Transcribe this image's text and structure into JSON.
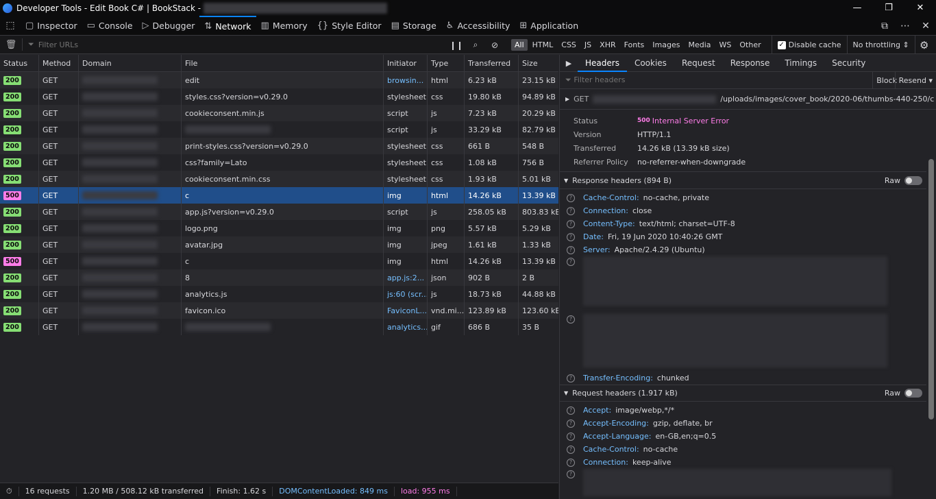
{
  "window": {
    "title": "Developer Tools - Edit Book C# | BookStack -"
  },
  "toolbar": {
    "tools": [
      "Inspector",
      "Console",
      "Debugger",
      "Network",
      "Memory",
      "Style Editor",
      "Storage",
      "Accessibility",
      "Application"
    ]
  },
  "filter": {
    "placeholder": "Filter URLs",
    "types": [
      "All",
      "HTML",
      "CSS",
      "JS",
      "XHR",
      "Fonts",
      "Images",
      "Media",
      "WS",
      "Other"
    ],
    "disable_cache": "Disable cache",
    "throttling": "No throttling ⇕"
  },
  "table": {
    "headers": [
      "Status",
      "Method",
      "Domain",
      "File",
      "Initiator",
      "Type",
      "Transferred",
      "Size"
    ],
    "rows": [
      {
        "status": "200",
        "method": "GET",
        "file": "edit",
        "initiator": "browsin...",
        "type": "html",
        "transferred": "6.23 kB",
        "size": "23.15 kB"
      },
      {
        "status": "200",
        "method": "GET",
        "file": "styles.css?version=v0.29.0",
        "initiator": "stylesheet",
        "type": "css",
        "transferred": "19.80 kB",
        "size": "94.89 kB"
      },
      {
        "status": "200",
        "method": "GET",
        "file": "cookieconsent.min.js",
        "initiator": "script",
        "type": "js",
        "transferred": "7.23 kB",
        "size": "20.29 kB"
      },
      {
        "status": "200",
        "method": "GET",
        "file": "",
        "initiator": "script",
        "type": "js",
        "transferred": "33.29 kB",
        "size": "82.79 kB"
      },
      {
        "status": "200",
        "method": "GET",
        "file": "print-styles.css?version=v0.29.0",
        "initiator": "stylesheet",
        "type": "css",
        "transferred": "661 B",
        "size": "548 B"
      },
      {
        "status": "200",
        "method": "GET",
        "file": "css?family=Lato",
        "initiator": "stylesheet",
        "type": "css",
        "transferred": "1.08 kB",
        "size": "756 B"
      },
      {
        "status": "200",
        "method": "GET",
        "file": "cookieconsent.min.css",
        "initiator": "stylesheet",
        "type": "css",
        "transferred": "1.93 kB",
        "size": "5.01 kB"
      },
      {
        "status": "500",
        "method": "GET",
        "file": "c",
        "initiator": "img",
        "type": "html",
        "transferred": "14.26 kB",
        "size": "13.39 kB"
      },
      {
        "status": "200",
        "method": "GET",
        "file": "app.js?version=v0.29.0",
        "initiator": "script",
        "type": "js",
        "transferred": "258.05 kB",
        "size": "803.83 kB"
      },
      {
        "status": "200",
        "method": "GET",
        "file": "logo.png",
        "initiator": "img",
        "type": "png",
        "transferred": "5.57 kB",
        "size": "5.29 kB"
      },
      {
        "status": "200",
        "method": "GET",
        "file": "avatar.jpg",
        "initiator": "img",
        "type": "jpeg",
        "transferred": "1.61 kB",
        "size": "1.33 kB"
      },
      {
        "status": "500",
        "method": "GET",
        "file": "c",
        "initiator": "img",
        "type": "html",
        "transferred": "14.26 kB",
        "size": "13.39 kB"
      },
      {
        "status": "200",
        "method": "GET",
        "file": "8",
        "initiator": "app.js:2...",
        "type": "json",
        "transferred": "902 B",
        "size": "2 B"
      },
      {
        "status": "200",
        "method": "GET",
        "file": "analytics.js",
        "initiator": "js:60 (scr...",
        "type": "js",
        "transferred": "18.73 kB",
        "size": "44.88 kB"
      },
      {
        "status": "200",
        "method": "GET",
        "file": "favicon.ico",
        "initiator": "FaviconL...",
        "type": "vnd.mi...",
        "transferred": "123.89 kB",
        "size": "123.60 kB"
      },
      {
        "status": "200",
        "method": "GET",
        "file": "",
        "initiator": "analytics...",
        "type": "gif",
        "transferred": "686 B",
        "size": "35 B"
      }
    ]
  },
  "statusbar": {
    "requests": "16 requests",
    "transferred": "1.20 MB / 508.12 kB transferred",
    "finish": "Finish: 1.62 s",
    "dcl": "DOMContentLoaded: 849 ms",
    "load": "load: 955 ms"
  },
  "details": {
    "tabs": [
      "Headers",
      "Cookies",
      "Request",
      "Response",
      "Timings",
      "Security"
    ],
    "filter_placeholder": "Filter headers",
    "block": "Block",
    "resend": "Resend ▾",
    "method": "GET",
    "url_tail": "/uploads/images/cover_book/2020-06/thumbs-440-250/c",
    "summary": [
      {
        "k": "Status",
        "v": "Internal Server Error",
        "code": "500"
      },
      {
        "k": "Version",
        "v": "HTTP/1.1"
      },
      {
        "k": "Transferred",
        "v": "14.26 kB (13.39 kB size)"
      },
      {
        "k": "Referrer Policy",
        "v": "no-referrer-when-downgrade"
      }
    ],
    "response_title": "Response headers (894 B)",
    "response": [
      {
        "k": "Cache-Control:",
        "v": "no-cache, private"
      },
      {
        "k": "Connection:",
        "v": "close"
      },
      {
        "k": "Content-Type:",
        "v": "text/html; charset=UTF-8"
      },
      {
        "k": "Date:",
        "v": "Fri, 19 Jun 2020 10:40:26 GMT"
      },
      {
        "k": "Server:",
        "v": "Apache/2.4.29 (Ubuntu)"
      }
    ],
    "transfer_enc": {
      "k": "Transfer-Encoding:",
      "v": "chunked"
    },
    "raw": "Raw",
    "request_title": "Request headers (1.917 kB)",
    "request": [
      {
        "k": "Accept:",
        "v": "image/webp,*/*"
      },
      {
        "k": "Accept-Encoding:",
        "v": "gzip, deflate, br"
      },
      {
        "k": "Accept-Language:",
        "v": "en-GB,en;q=0.5"
      },
      {
        "k": "Cache-Control:",
        "v": "no-cache"
      },
      {
        "k": "Connection:",
        "v": "keep-alive"
      }
    ]
  }
}
